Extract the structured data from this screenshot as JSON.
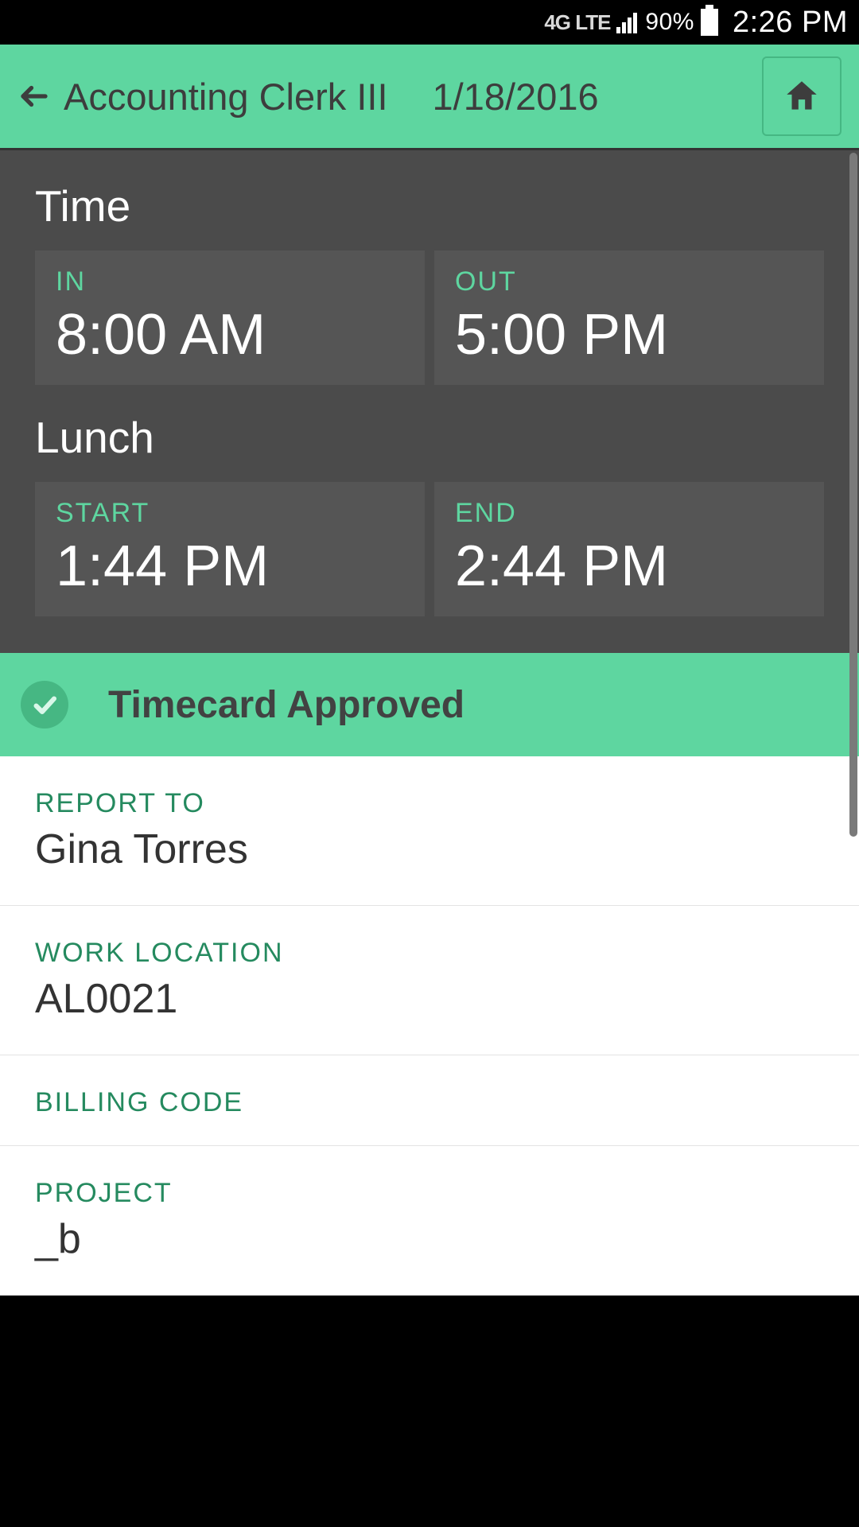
{
  "status": {
    "network": "4G LTE",
    "battery_pct": "90%",
    "clock": "2:26 PM"
  },
  "header": {
    "title": "Accounting Clerk III",
    "date": "1/18/2016"
  },
  "time_section": {
    "heading": "Time",
    "in_label": "IN",
    "in_value": "8:00 AM",
    "out_label": "OUT",
    "out_value": "5:00 PM"
  },
  "lunch_section": {
    "heading": "Lunch",
    "start_label": "START",
    "start_value": "1:44 PM",
    "end_label": "END",
    "end_value": "2:44 PM"
  },
  "approval": {
    "text": "Timecard Approved"
  },
  "details": {
    "report_to_label": "REPORT TO",
    "report_to_value": "Gina Torres",
    "work_location_label": "WORK LOCATION",
    "work_location_value": "AL0021",
    "billing_code_label": "BILLING CODE",
    "billing_code_value": "",
    "project_label": "PROJECT",
    "project_value": "_b"
  }
}
